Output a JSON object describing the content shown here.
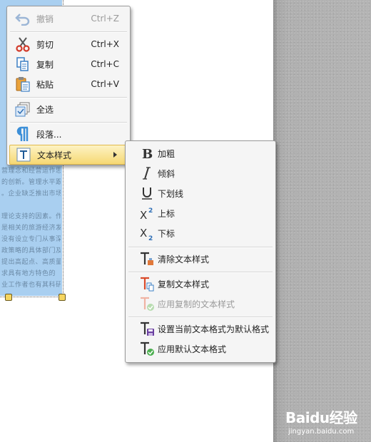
{
  "menu": {
    "items": [
      {
        "label": "撤销",
        "shortcut": "Ctrl+Z",
        "icon": "undo-icon",
        "disabled": true
      },
      {
        "label": "剪切",
        "shortcut": "Ctrl+X",
        "icon": "scissors-icon"
      },
      {
        "label": "复制",
        "shortcut": "Ctrl+C",
        "icon": "copy-icon"
      },
      {
        "label": "粘贴",
        "shortcut": "Ctrl+V",
        "icon": "paste-icon"
      },
      {
        "label": "全选",
        "icon": "select-all-icon"
      },
      {
        "label": "段落...",
        "icon": "paragraph-icon"
      },
      {
        "label": "文本样式",
        "icon": "text-style-icon",
        "has_submenu": true,
        "highlighted": true
      }
    ]
  },
  "submenu": {
    "items": [
      {
        "label": "加粗",
        "icon": "bold-icon"
      },
      {
        "label": "倾斜",
        "icon": "italic-icon"
      },
      {
        "label": "下划线",
        "icon": "underline-icon"
      },
      {
        "label": "上标",
        "icon": "superscript-icon"
      },
      {
        "label": "下标",
        "icon": "subscript-icon"
      },
      {
        "label": "清除文本样式",
        "icon": "clear-style-icon"
      },
      {
        "label": "复制文本样式",
        "icon": "copy-style-icon"
      },
      {
        "label": "应用复制的文本样式",
        "icon": "apply-copied-style-icon",
        "disabled": true
      },
      {
        "label": "设置当前文本格式为默认格式",
        "icon": "set-default-style-icon"
      },
      {
        "label": "应用默认文本格式",
        "icon": "apply-default-style-icon"
      }
    ]
  },
  "background_text": {
    "lines": [
      "营理念和经营运作思维",
      "的创新。管理水平跟不",
      "。企业缺乏推出市场的",
      "",
      "理论支持的因素。作",
      "是相关的旅游经济发展",
      "没有设立专门从事深入",
      "政策略的具体部门及",
      "提出高起点、高质量、",
      "求具有地方特色的",
      "业工作者也有其科研。"
    ]
  },
  "watermark": {
    "brand": "Baidu经验",
    "url": "jingyan.baidu.com"
  },
  "colors": {
    "highlight": "#f6d873",
    "selection": "#a9cff0",
    "disabled": "#9a9a9a"
  }
}
